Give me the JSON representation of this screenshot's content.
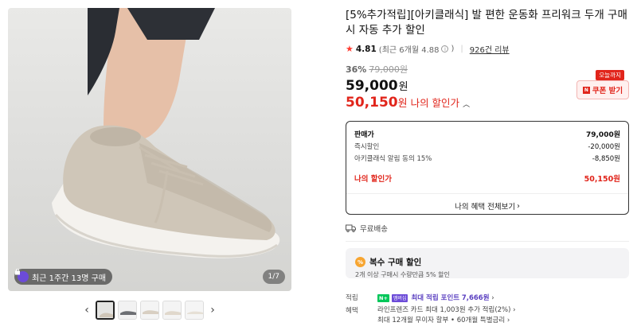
{
  "gallery": {
    "buyer_badge": "최근 1주간 13명 구매",
    "page_indicator": "1/7",
    "thumb_count": 5
  },
  "product": {
    "title": "[5%추가적립][아키클래식] 발 편한 운동화 프리워크 두개 구매시 자동 추가 할인",
    "rating": "4.81",
    "rating_detail": "(최근 6개월 4.88",
    "rating_close": ")",
    "review_link": "926건 리뷰",
    "discount_rate": "36%",
    "original_price": "79,000원",
    "sale_price": "59,000",
    "sale_unit": "원",
    "my_price": "50,150",
    "my_unit": "원",
    "my_discount_label": "나의 할인가",
    "coupon_tag": "오늘까지",
    "coupon_button": "쿠폰 받기"
  },
  "breakdown": {
    "rows": [
      {
        "label": "판매가",
        "value": "79,000원"
      },
      {
        "label": "즉시할인",
        "value": "-20,000원"
      },
      {
        "label": "아키클래식 알림 동의 15%",
        "value": "-8,850원"
      }
    ],
    "total_label": "나의 할인가",
    "total_value": "50,150원",
    "all_benefits": "나의 혜택 전체보기"
  },
  "shipping": "무료배송",
  "multi_discount": {
    "title": "복수 구매 할인",
    "subtitle": "2개 이상 구매시 수량만큼 5% 할인"
  },
  "extras": {
    "points_label": "적립",
    "npay_badge": "N+",
    "membership_badge": "멤버십",
    "points_text": "최대 적립 포인트",
    "points_value": "7,666원",
    "benefit_label": "혜택",
    "benefit_line1": "라인프렌즈 카드 최대 1,003원 추가 적립(2%)",
    "benefit_line2": "최대 12개월 무이자 할부 • 60개월 특별금리"
  },
  "colors": {
    "accent_red": "#e1251b",
    "npay_green": "#03c75a",
    "purple": "#5a3fc0"
  }
}
